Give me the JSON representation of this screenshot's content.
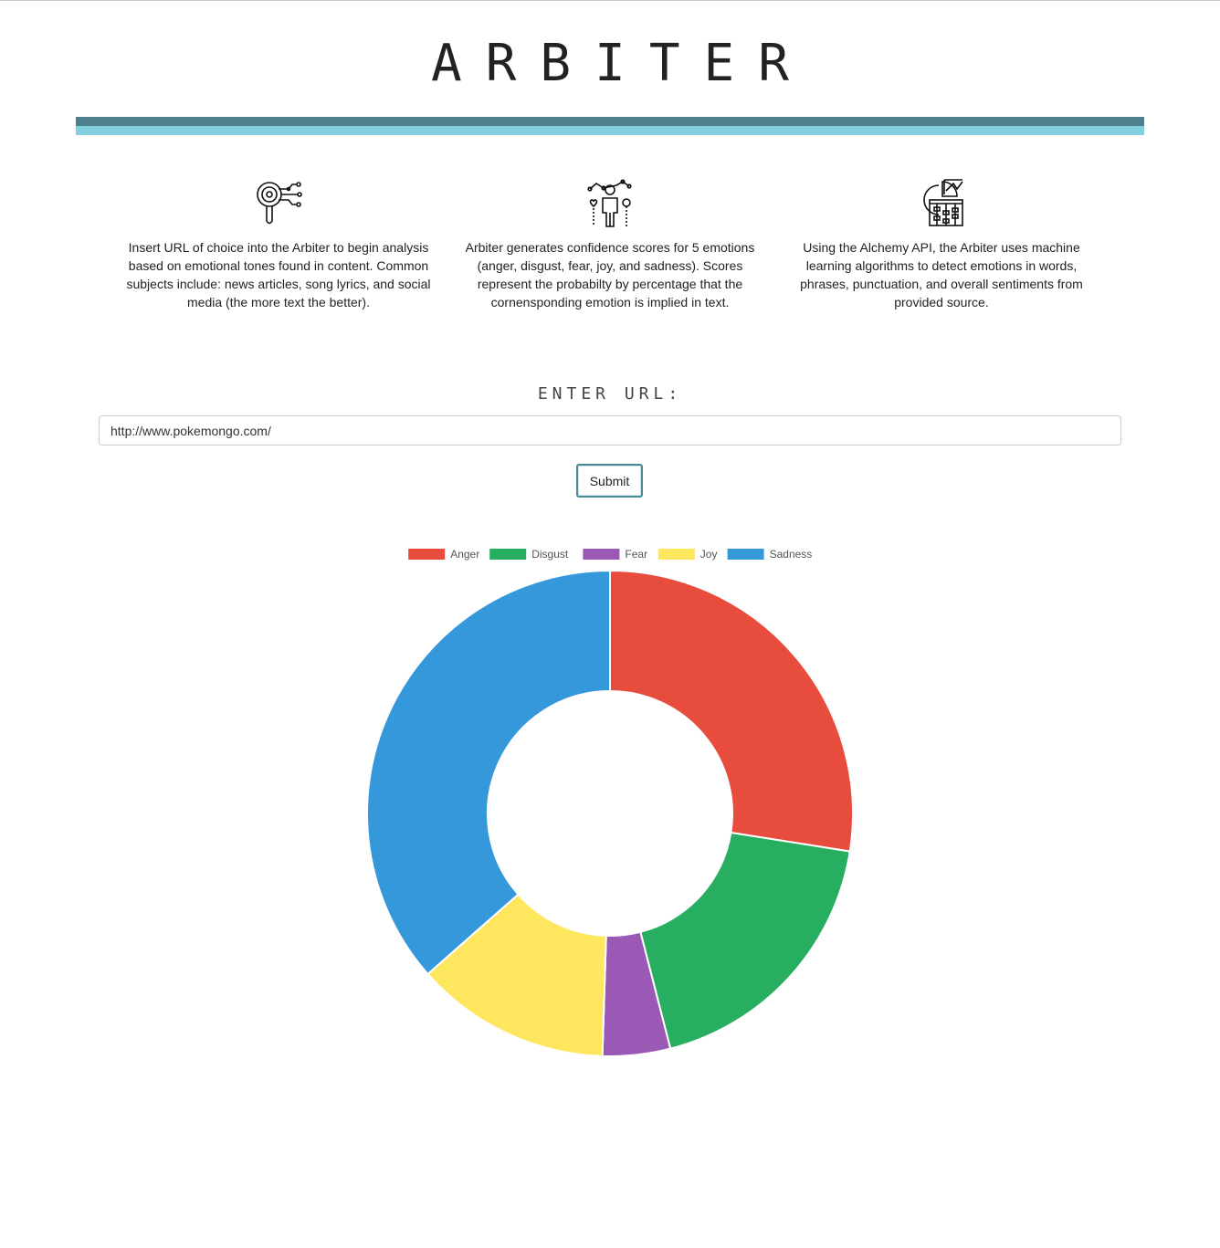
{
  "app": {
    "title": "ARBITER"
  },
  "header": {
    "bar_dark_color": "#4e7f8c",
    "bar_light_color": "#82cfe0"
  },
  "features": [
    {
      "icon": "magnifier-circuit-icon",
      "text": "Insert URL of choice into the Arbiter to begin analysis based on emotional tones found in content. Common subjects include: news articles, song lyrics, and social media (the more text the better)."
    },
    {
      "icon": "person-emotions-icon",
      "text": "Arbiter generates confidence scores for 5 emotions (anger, disgust, fear, joy, and sadness). Scores represent the probabilty by percentage that the cornensponding emotion is implied in text."
    },
    {
      "icon": "analytics-abacus-icon",
      "text": "Using the Alchemy API, the Arbiter uses machine learning algorithms to detect emotions in words, phrases, punctuation, and overall sentiments from provided source."
    }
  ],
  "form": {
    "label": "ENTER URL:",
    "url_value": "http://www.pokemongo.com/",
    "submit_label": "Submit"
  },
  "chart_data": {
    "type": "pie",
    "categories": [
      "Anger",
      "Disgust",
      "Fear",
      "Joy",
      "Sadness"
    ],
    "values": [
      27.5,
      18.5,
      4.5,
      13.0,
      36.5
    ],
    "colors": [
      "#e74c3c",
      "#27ae60",
      "#9b59b6",
      "#fee65e",
      "#3498db"
    ],
    "donut": true,
    "legend_position": "top",
    "title": ""
  }
}
